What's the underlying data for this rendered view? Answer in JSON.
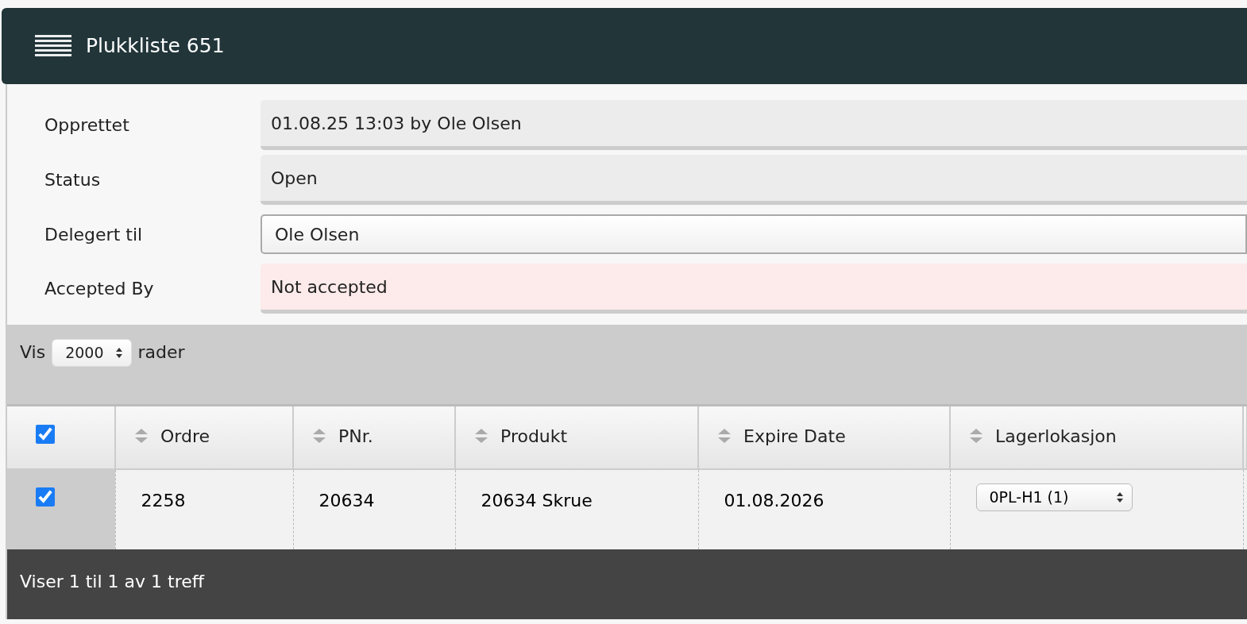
{
  "header": {
    "title": "Plukkliste 651"
  },
  "fields": [
    {
      "label": "Opprettet",
      "kind": "readonly",
      "value": "01.08.25 13:03 by Ole Olsen"
    },
    {
      "label": "Status",
      "kind": "readonly",
      "value": "Open"
    },
    {
      "label": "Delegert til",
      "kind": "select",
      "value": "Ole Olsen"
    },
    {
      "label": "Accepted By",
      "kind": "alert",
      "value": "Not accepted"
    }
  ],
  "length_control": {
    "before": "Vis",
    "value": "2000",
    "after": "rader"
  },
  "table": {
    "select_all_checked": true,
    "columns": [
      "Ordre",
      "PNr.",
      "Produkt",
      "Expire Date",
      "Lagerlokasjon"
    ],
    "rows": [
      {
        "checked": true,
        "cells": [
          {
            "kind": "text",
            "value": "2258"
          },
          {
            "kind": "text",
            "value": "20634"
          },
          {
            "kind": "text",
            "value": "20634 Skrue"
          },
          {
            "kind": "text",
            "value": "01.08.2026"
          },
          {
            "kind": "select",
            "value": "0PL-H1 (1)"
          }
        ]
      }
    ]
  },
  "footer": {
    "info": "Viser 1 til 1 av 1 treff"
  }
}
